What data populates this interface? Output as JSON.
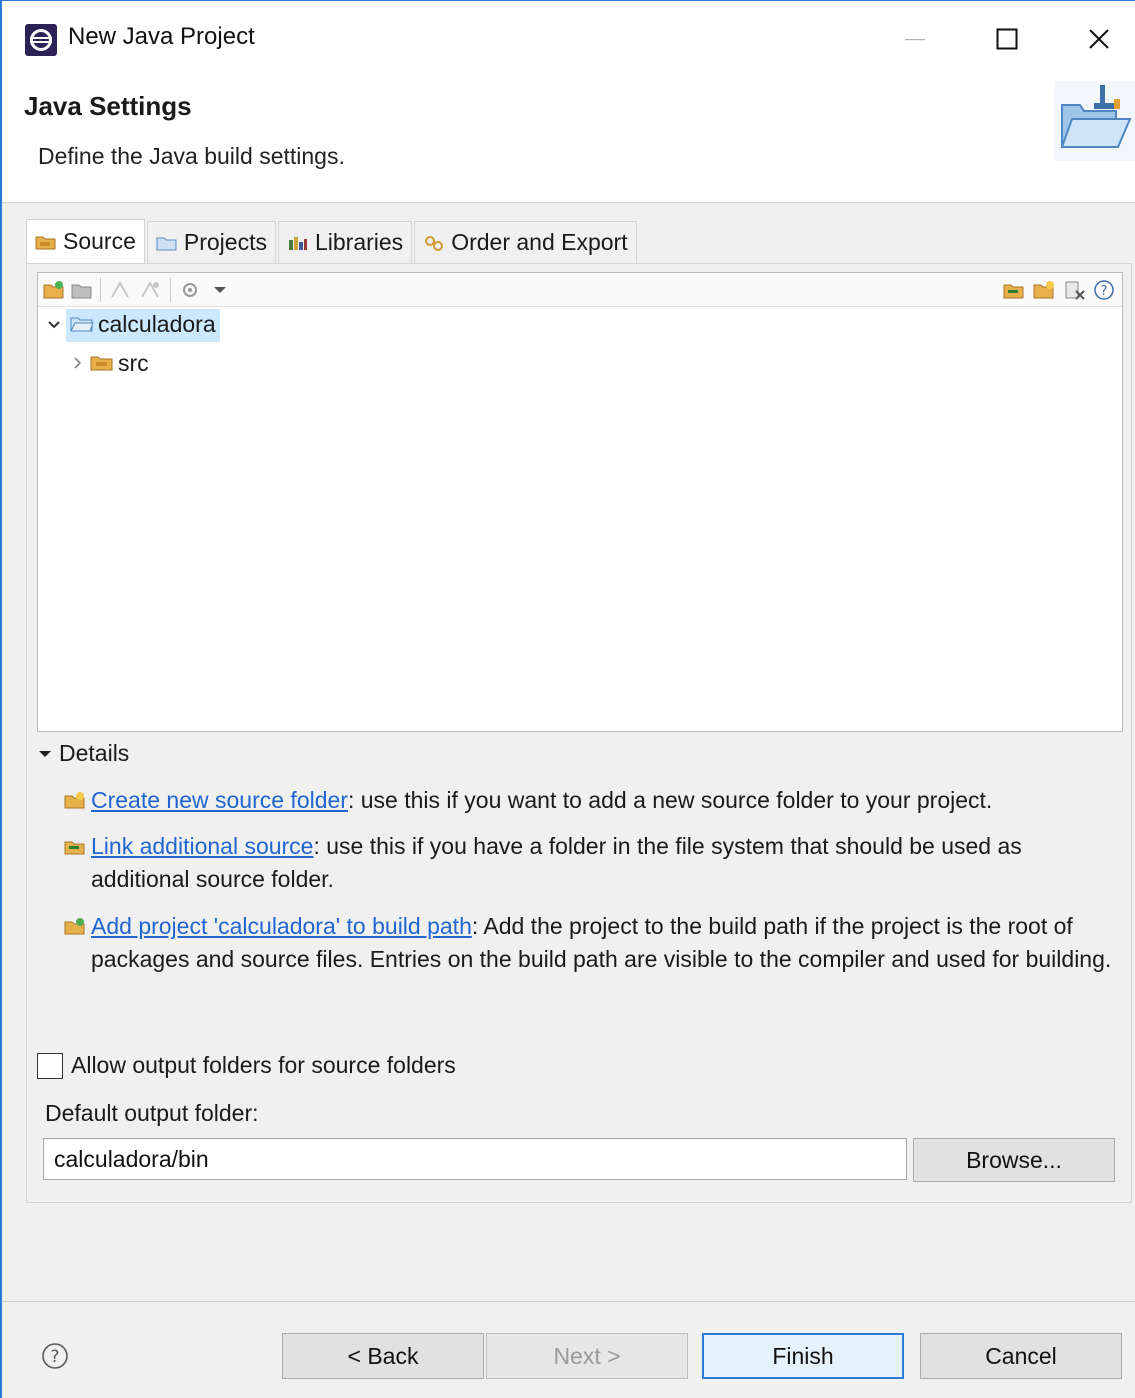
{
  "window": {
    "title": "New Java Project"
  },
  "header": {
    "title": "Java Settings",
    "description": "Define the Java build settings."
  },
  "tabs": [
    {
      "label": "Source",
      "icon": "source-folder-icon",
      "active": true
    },
    {
      "label": "Projects",
      "icon": "projects-icon",
      "active": false
    },
    {
      "label": "Libraries",
      "icon": "libraries-icon",
      "active": false
    },
    {
      "label": "Order and Export",
      "icon": "order-export-icon",
      "active": false
    }
  ],
  "tree": {
    "root": {
      "label": "calculadora",
      "expanded": true,
      "selected": true
    },
    "children": [
      {
        "label": "src",
        "expanded": false
      }
    ]
  },
  "details": {
    "heading": "Details",
    "items": [
      {
        "link": "Create new source folder",
        "text": ": use this if you want to add a new source folder to your project."
      },
      {
        "link": "Link additional source",
        "text": ": use this if you have a folder in the file system that should be used as additional source folder."
      },
      {
        "link": "Add project 'calculadora' to build path",
        "text": ": Add the project to the build path if the project is the root of packages and source files. Entries on the build path are visible to the compiler and used for building."
      }
    ]
  },
  "options": {
    "allow_output_folders": {
      "label": "Allow output folders for source folders",
      "checked": false
    },
    "default_output_label": "Default output folder:",
    "default_output_value": "calculadora/bin",
    "browse_label": "Browse..."
  },
  "footer": {
    "back_label": "< Back",
    "next_label": "Next >",
    "finish_label": "Finish",
    "cancel_label": "Cancel"
  },
  "colors": {
    "accent": "#2b7bd6",
    "link": "#1f66d1",
    "selection": "#cce8ff"
  }
}
